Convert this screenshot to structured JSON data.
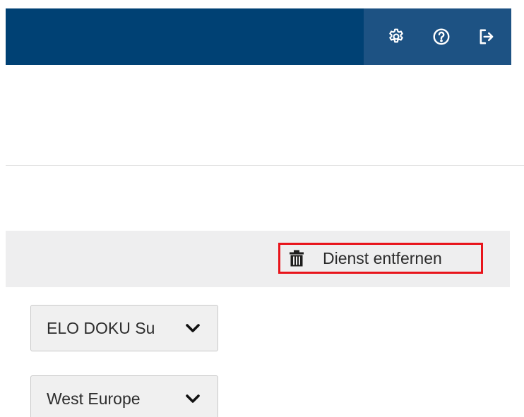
{
  "header": {
    "icons": [
      "gear-icon",
      "help-icon",
      "logout-icon"
    ],
    "background_color": "#004174",
    "actions_background_color": "#1d5283"
  },
  "toolbar": {
    "remove_service_label": "Dienst entfernen",
    "remove_service_icon": "trash-icon",
    "highlight_color": "#e8141b"
  },
  "form": {
    "selects": [
      {
        "value": "ELO DOKU Su"
      },
      {
        "value": "West Europe"
      }
    ]
  }
}
